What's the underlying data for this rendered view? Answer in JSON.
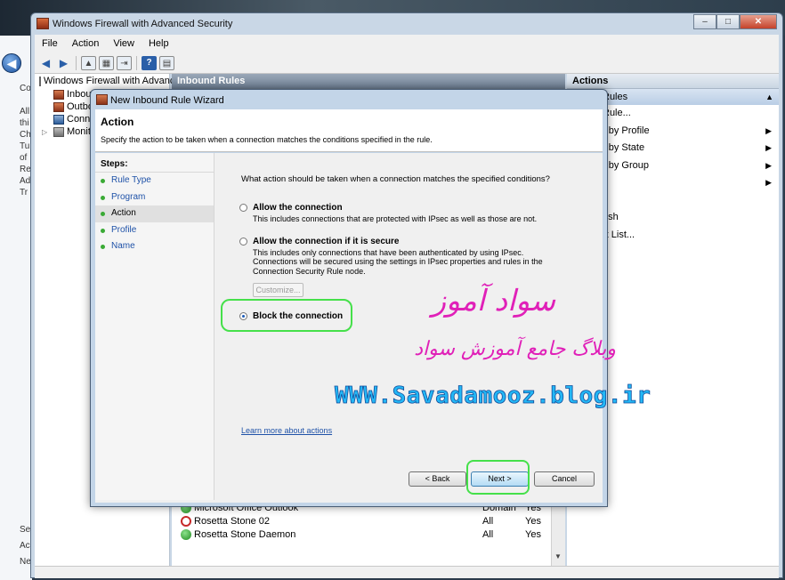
{
  "window": {
    "title": "Windows Firewall with Advanced Security",
    "buttons": [
      "–",
      "□",
      "✕"
    ]
  },
  "menu": [
    "File",
    "Action",
    "View",
    "Help"
  ],
  "tree": {
    "root": "Windows Firewall with Advance",
    "children": [
      "Inbou",
      "Outbo",
      "Conne",
      "Monit"
    ]
  },
  "center": {
    "header": "Inbound Rules",
    "rows": [
      {
        "name": "Microsoft Office Outlook",
        "profile": "Domain",
        "enabled": "Yes",
        "status": "ok"
      },
      {
        "name": "Rosetta Stone 02",
        "profile": "All",
        "enabled": "Yes",
        "status": "blocked"
      },
      {
        "name": "Rosetta Stone Daemon",
        "profile": "All",
        "enabled": "Yes",
        "status": "ok"
      }
    ]
  },
  "actions": {
    "header": "Actions",
    "subheader": "Rules",
    "items": [
      {
        "label": "Rule...",
        "arrow": ""
      },
      {
        "label": "r by Profile",
        "arrow": "▶"
      },
      {
        "label": "r by State",
        "arrow": "▶"
      },
      {
        "label": "r by Group",
        "arrow": "▶"
      },
      {
        "label": "",
        "arrow": "▶"
      },
      {
        "label": "",
        "arrow": ""
      },
      {
        "label": "esh",
        "arrow": ""
      },
      {
        "label": "rt List...",
        "arrow": ""
      }
    ]
  },
  "background_left": {
    "items": [
      "Co",
      "",
      "All",
      "thi",
      "Ch",
      "Tu",
      "of",
      "Re",
      "Ad",
      "Tr"
    ]
  },
  "background_left_bottom": [
    "Se",
    "Ac",
    "Ne"
  ],
  "wizard": {
    "title": "New Inbound Rule Wizard",
    "heading": "Action",
    "subheading": "Specify the action to be taken when a connection matches the conditions specified in the rule.",
    "steps_header": "Steps:",
    "steps": [
      "Rule Type",
      "Program",
      "Action",
      "Profile",
      "Name"
    ],
    "current_step": "Action",
    "question": "What action should be taken when a connection matches the specified conditions?",
    "options": [
      {
        "label": "Allow the connection",
        "desc": "This includes connections that are protected with IPsec as well as those are not.",
        "selected": false
      },
      {
        "label": "Allow the connection if it is secure",
        "desc": "This includes only connections that have been authenticated by using IPsec.  Connections will be secured using the settings in IPsec properties and rules in the Connection Security Rule node.",
        "selected": false
      },
      {
        "label": "Block the connection",
        "desc": "",
        "selected": true
      }
    ],
    "customize": "Customize...",
    "learn_more": "Learn more about actions",
    "back": "< Back",
    "next": "Next >",
    "cancel": "Cancel"
  },
  "watermark": {
    "title": "سواد آموز",
    "subtitle": "وبلاگ جامع آموزش سواد",
    "url": "WWW.Savadamooz.blog.ir"
  },
  "colors": {
    "highlight": "#45e04a",
    "watermark_pink": "#e020b8",
    "watermark_blue": "#23b7f5",
    "link": "#1f52a8"
  }
}
